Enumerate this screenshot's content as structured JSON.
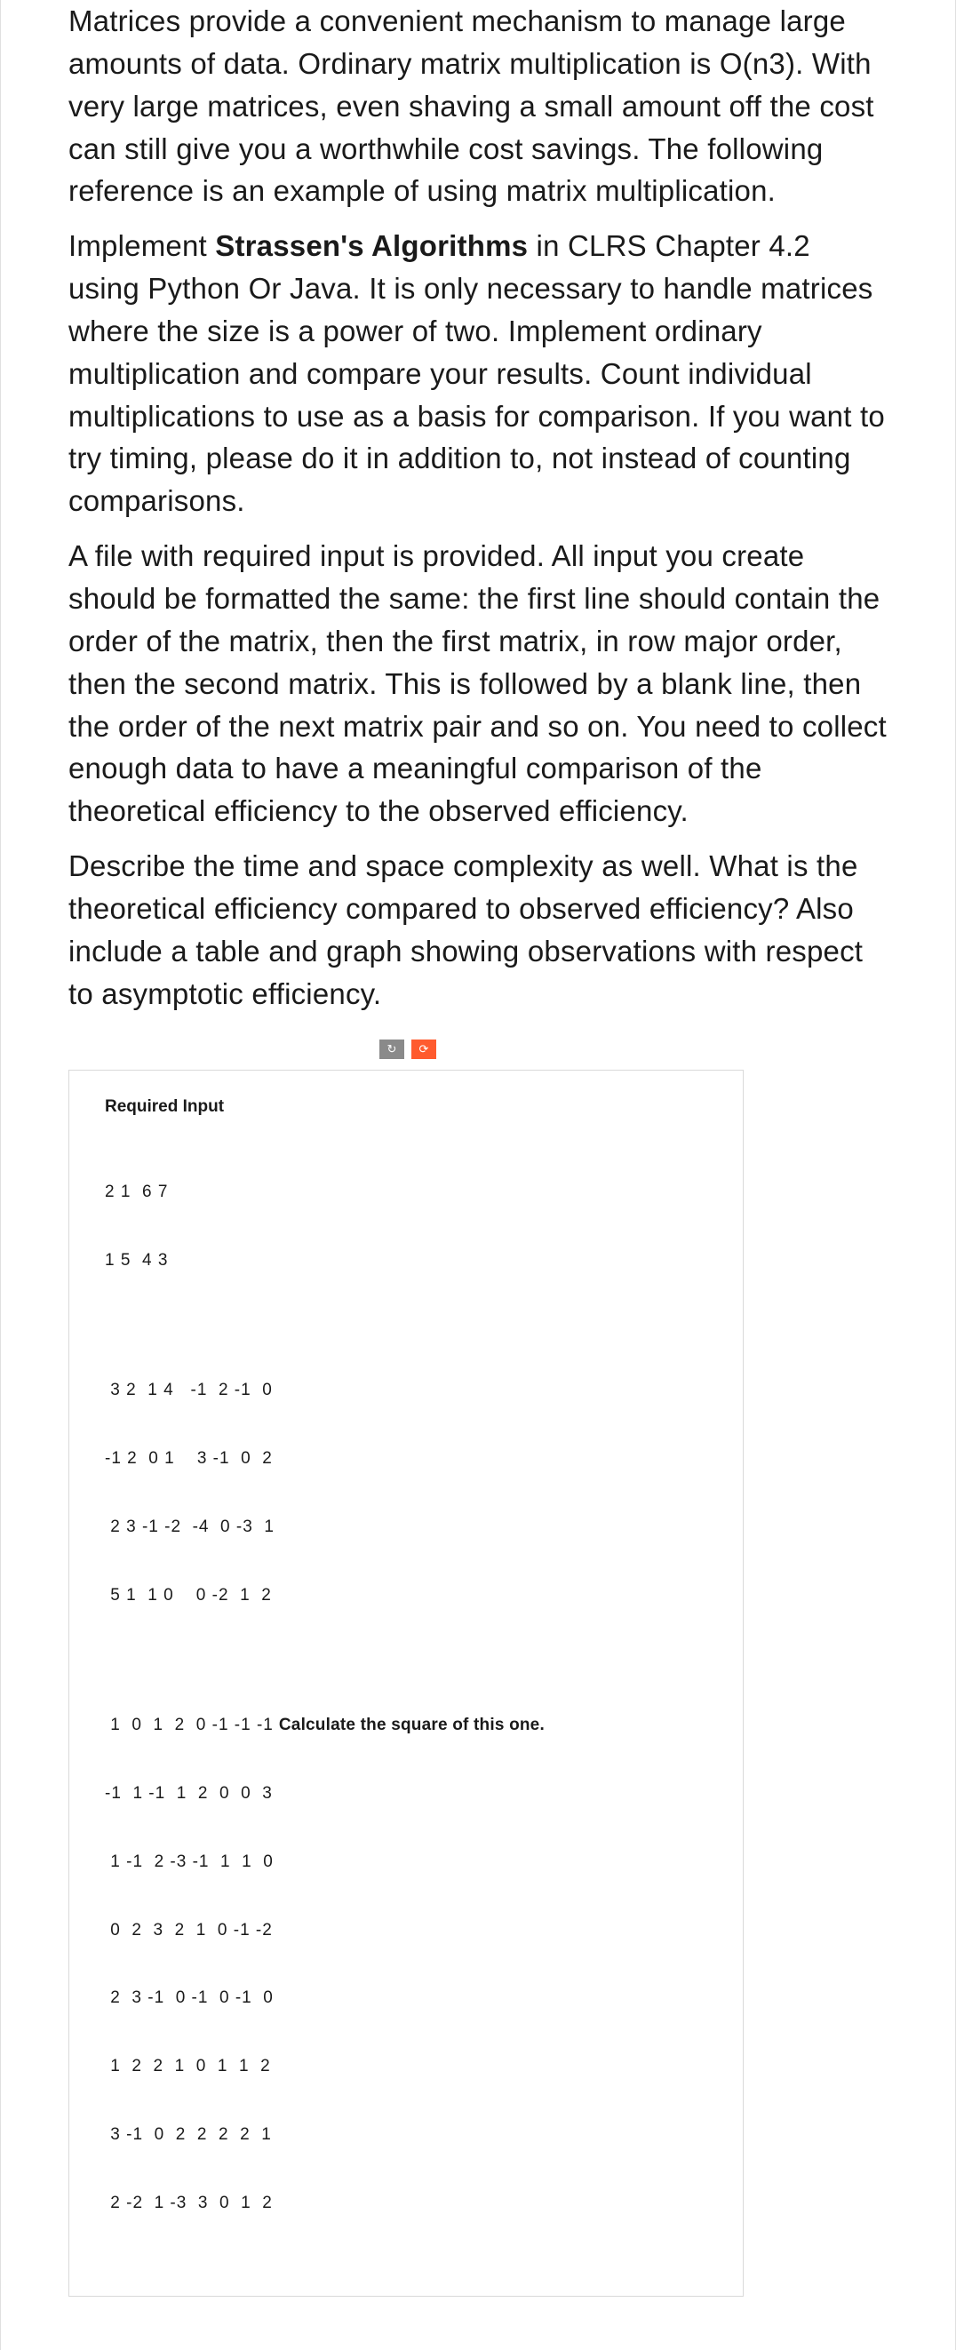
{
  "paragraphs": {
    "p1": "Matrices provide a convenient mechanism to manage large amounts of data. Ordinary matrix multiplication is O(n3). With very large matrices, even shaving a small amount off the cost can still give you a worthwhile cost savings. The following reference is an example of using matrix multiplication.",
    "p2_a": "Implement ",
    "p2_b": "Strassen's Algorithms",
    "p2_c": " in CLRS Chapter 4.2 using Python Or Java. It is only necessary to handle matrices where the size is a power of two. Implement ordinary multiplication and compare your results. Count individual multiplications to use as a basis for comparison. If you want to try timing, please do it in addition to, not instead of counting comparisons.",
    "p3": "A file with required input is provided. All input you create should be formatted the same: the first line should contain the order of the matrix, then the first matrix, in row major order, then the second matrix. This is followed by a blank line, then the order of the next matrix pair and so on. You need to collect enough data to have a meaningful comparison of the theoretical efficiency to the observed efficiency.",
    "p4": "Describe the time and space complexity as well. What is the theoretical efficiency compared to observed efficiency? Also include a table and graph showing observations with respect to asymptotic efficiency."
  },
  "required_input": {
    "title": "Required Input",
    "block1": [
      "2 1  6 7",
      "1 5  4 3"
    ],
    "block2": [
      " 3 2  1 4   -1  2 -1  0",
      "-1 2  0 1    3 -1  0  2",
      " 2 3 -1 -2  -4  0 -3  1",
      " 5 1  1 0    0 -2  1  2"
    ],
    "block3_first": " 1  0  1  2  0 -1 -1 -1",
    "calc_label": "Calculate the square of this one.",
    "block3_rest": [
      "-1  1 -1  1  2  0  0  3",
      " 1 -1  2 -3 -1  1  1  0",
      " 0  2  3  2  1  0 -1 -2",
      " 2  3 -1  0 -1  0 -1  0",
      " 1  2  2  1  0  1  1  2",
      " 3 -1  0  2  2  2  2  1",
      " 2 -2  1 -3  3  0  1  2"
    ]
  },
  "icons": {
    "refresh": "↻",
    "reload": "⟳"
  }
}
